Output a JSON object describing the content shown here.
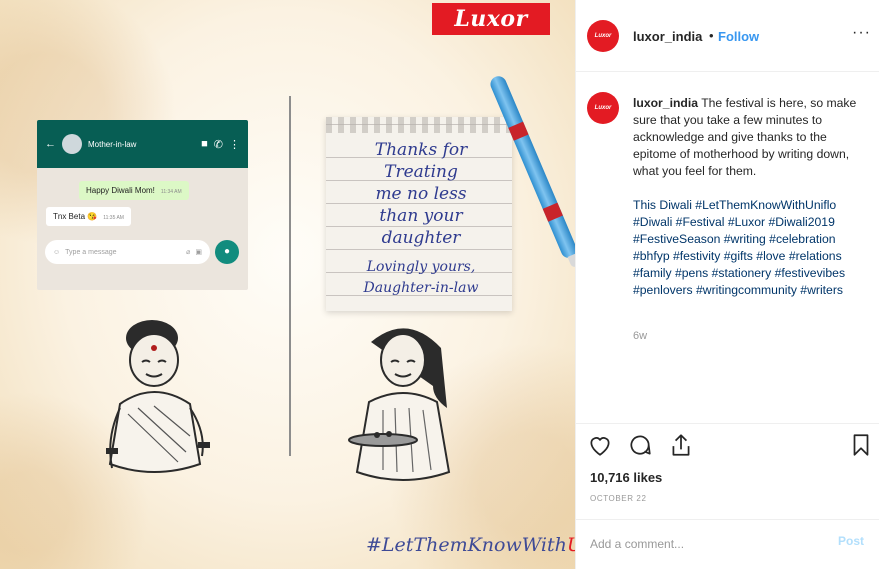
{
  "image": {
    "brand_logo": "Luxor",
    "chat": {
      "contact_name": "Mother-in-law",
      "sent_message": "Happy Diwali Mom!",
      "sent_time": "11:34 AM",
      "received_message": "Tnx Beta 😘",
      "received_time": "11:35 AM",
      "input_placeholder": "Type a message",
      "header_color": "#075e54"
    },
    "note_lines": [
      "Thanks for",
      "Treating",
      "me no less",
      "than your",
      "daughter"
    ],
    "note_signature": [
      "Lovingly yours,",
      "Daughter-in-law"
    ],
    "hashtag_main": "#LetThemKnowWith",
    "hashtag_accent": "Uniflo"
  },
  "header": {
    "username": "luxor_india",
    "separator": "•",
    "follow_label": "Follow",
    "more_icon": "ellipsis-icon",
    "avatar_text": "Luxor",
    "brand_color": "#e31b23"
  },
  "caption": {
    "username": "luxor_india",
    "text": "The festival is here, so make sure that you take a few minutes to acknowledge and give thanks to the epitome of motherhood by writing down, what you feel for them.",
    "hashtags": "This Diwali #LetThemKnowWithUniflo #Diwali #Festival #Luxor #Diwali2019 #FestiveSeason #writing #celebration #bhfyp #festivity #gifts #love #relations #family #pens #stationery #festivevibes #penlovers #writingcommunity #writers",
    "time_ago": "6w"
  },
  "actions": {
    "like_icon": "heart-icon",
    "comment_icon": "comment-icon",
    "share_icon": "share-icon",
    "save_icon": "bookmark-icon"
  },
  "likes": "10,716 likes",
  "date": "OCTOBER 22",
  "comment": {
    "placeholder": "Add a comment...",
    "post_label": "Post",
    "accent_color": "#3897f0"
  }
}
